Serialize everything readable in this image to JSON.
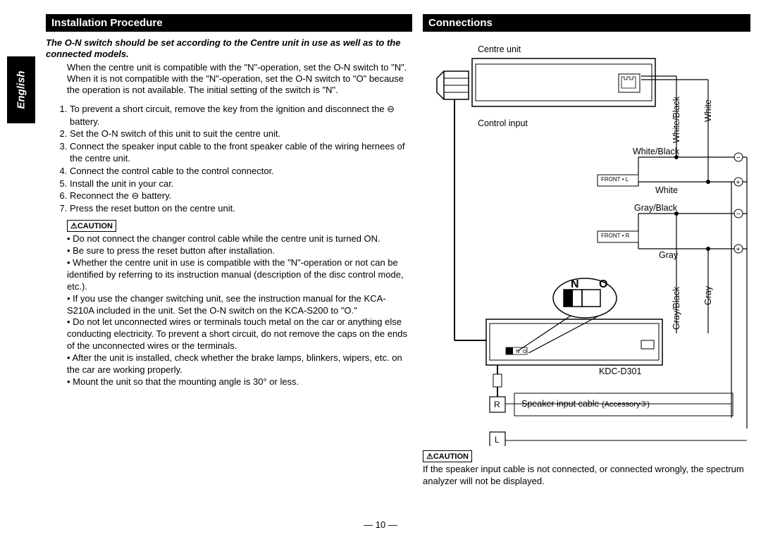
{
  "side_tab": "English",
  "page_number": "— 10 —",
  "left": {
    "header": "Installation Procedure",
    "intro_bold": "The O-N switch should be set according to the Centre unit in use as well as to the connected models.",
    "intro_desc": "When the centre unit is compatible with the \"N\"-operation, set the O-N switch to \"N\". When it is not compatible with the \"N\"-operation, set the O-N switch to \"O\" because the operation is not available. The initial setting of the switch is \"N\".",
    "steps": [
      "To prevent a short circuit, remove the key from the ignition and disconnect the ⊖ battery.",
      "Set the O-N switch of this unit to suit the centre unit.",
      "Connect the speaker input cable to the front speaker cable of the wiring hernees of the centre unit.",
      "Connect the control cable to the control connector.",
      "Install the unit in your car.",
      "Reconnect the ⊖ battery.",
      "Press the reset button on the centre unit."
    ],
    "caution_label": "⚠CAUTION",
    "cautions": [
      "Do not connect the changer control cable while the centre unit is turned ON.",
      "Be sure to press the reset button after installation.",
      "Whether the centre unit in use is compatible with the \"N\"-operation or not can be identified by referring to its instruction manual (description of the disc control mode, etc.).",
      "If you use the changer switching unit, see the instruction manual for the KCA-S210A included in the unit. Set the O-N switch on the KCA-S200 to \"O.\"",
      "Do not let unconnected wires or terminals touch metal on the car or anything else conducting electricity. To prevent a short circuit, do not remove the caps on the ends of the unconnected wires or the terminals.",
      "After the unit is installed, check whether the brake lamps, blinkers, wipers, etc. on the car are working properly.",
      "Mount the unit so that the mounting angle is 30° or less."
    ]
  },
  "right": {
    "header": "Connections",
    "labels": {
      "centre_unit": "Centre unit",
      "control_input": "Control input",
      "white_black": "White/Black",
      "white": "White",
      "gray_black": "Gray/Black",
      "gray": "Gray",
      "front_l": "FRONT • L",
      "front_r": "FRONT • R",
      "model": "KDC-D301",
      "switch_n": "N",
      "switch_o": "O",
      "switch_n_small": "N",
      "switch_o_small": "O",
      "r": "R",
      "l": "L",
      "speaker_cable": "Speaker input cable",
      "accessory": "(Accessory③)"
    },
    "caution_label": "⚠CAUTION",
    "caution_text": "If the speaker input cable is not connected, or connected wrongly, the spectrum analyzer will not be displayed."
  }
}
